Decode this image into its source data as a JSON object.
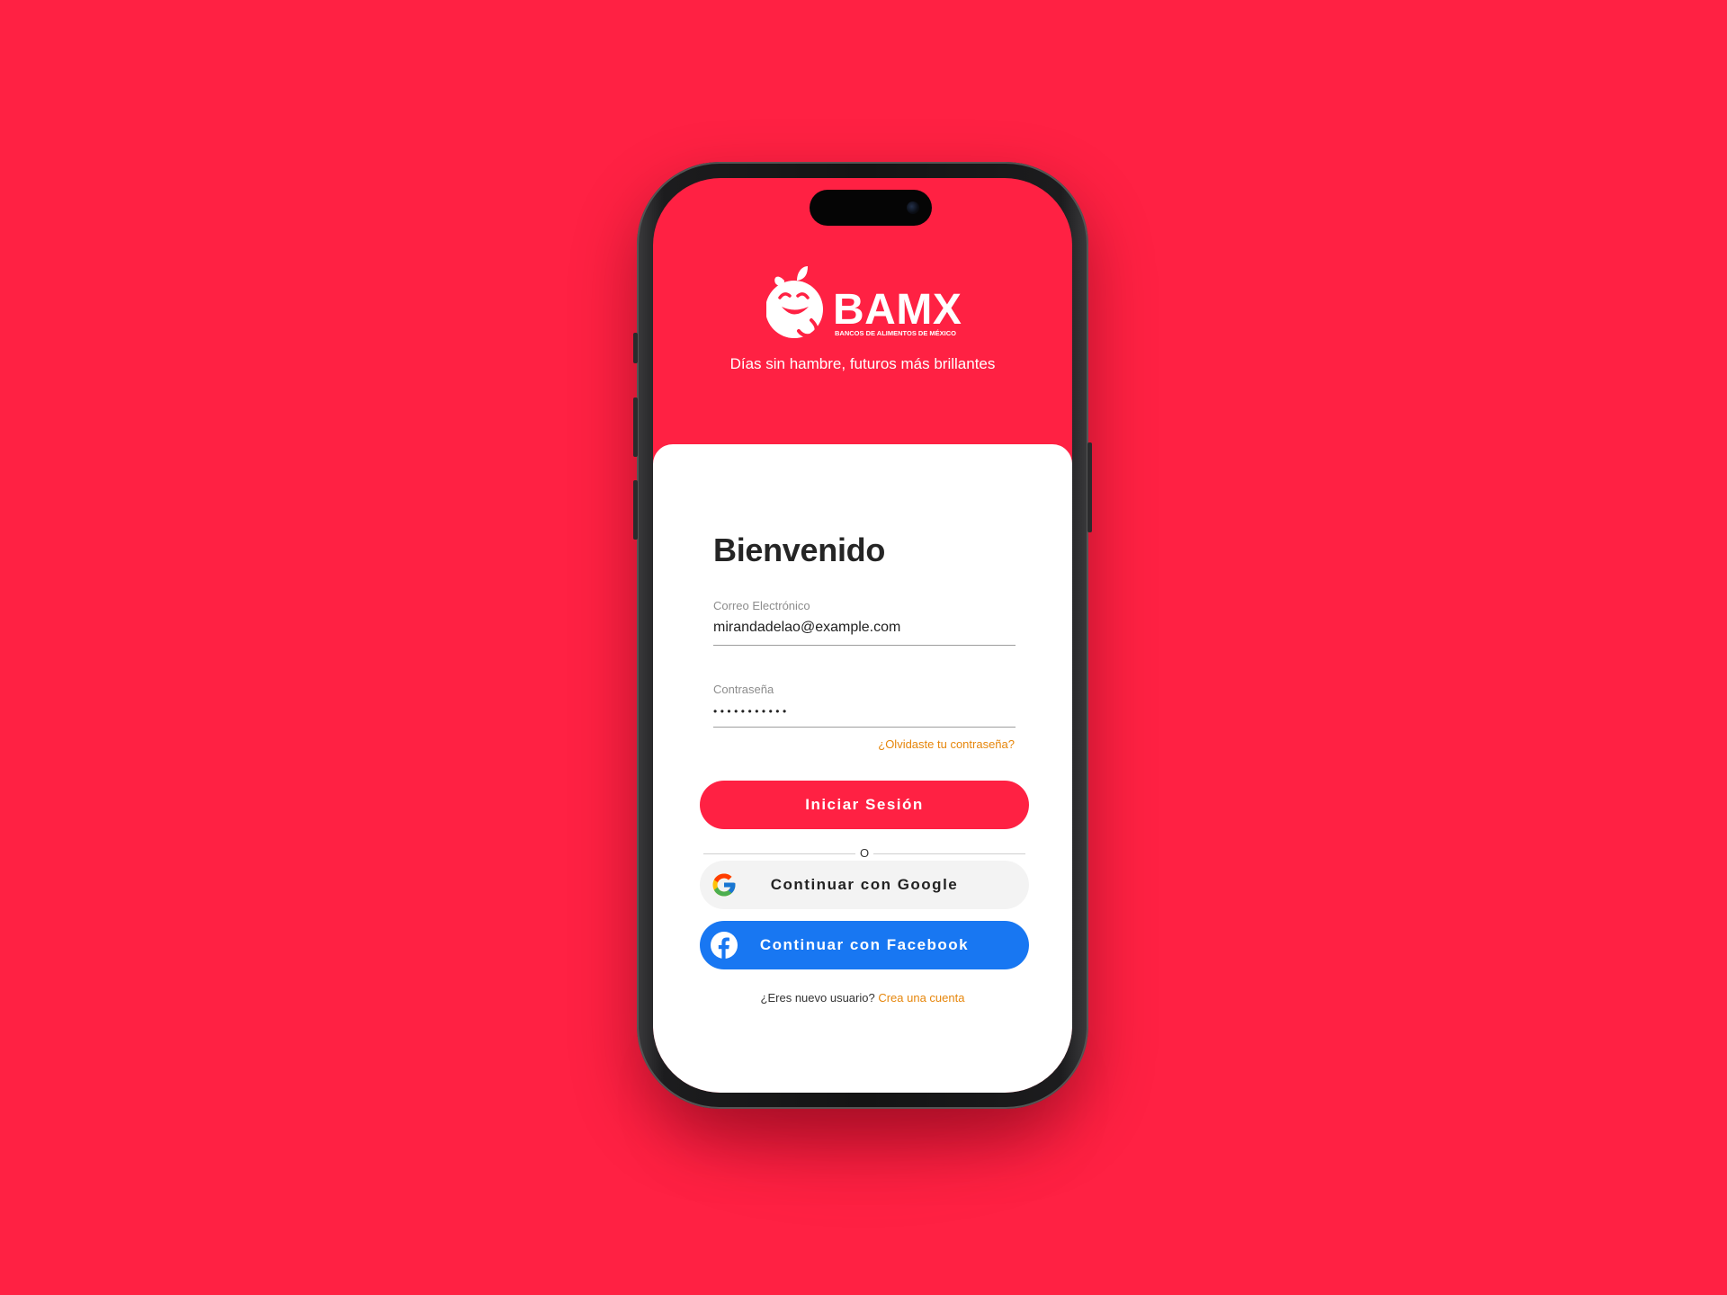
{
  "brand": {
    "logo_text": "BAMX",
    "logo_subtitle": "BANCOS DE ALIMENTOS DE MÉXICO",
    "tagline": "Días sin hambre, futuros más brillantes",
    "primary_color": "#FF2143",
    "accent_color": "#E6860B"
  },
  "login": {
    "title": "Bienvenido",
    "email_label": "Correo Electrónico",
    "email_value": "mirandadelao@example.com",
    "password_label": "Contraseña",
    "password_value": "•••••••••••",
    "forgot_link": "¿Olvidaste tu contraseña?",
    "submit_label": "Iniciar Sesión",
    "divider_text": "O"
  },
  "social": {
    "google_label": "Continuar con Google",
    "google_icon": "google-icon",
    "facebook_label": "Continuar con Facebook",
    "facebook_icon": "facebook-icon",
    "facebook_color": "#1877F2"
  },
  "signup": {
    "prompt": "¿Eres nuevo usuario?",
    "link": "Crea una cuenta"
  }
}
